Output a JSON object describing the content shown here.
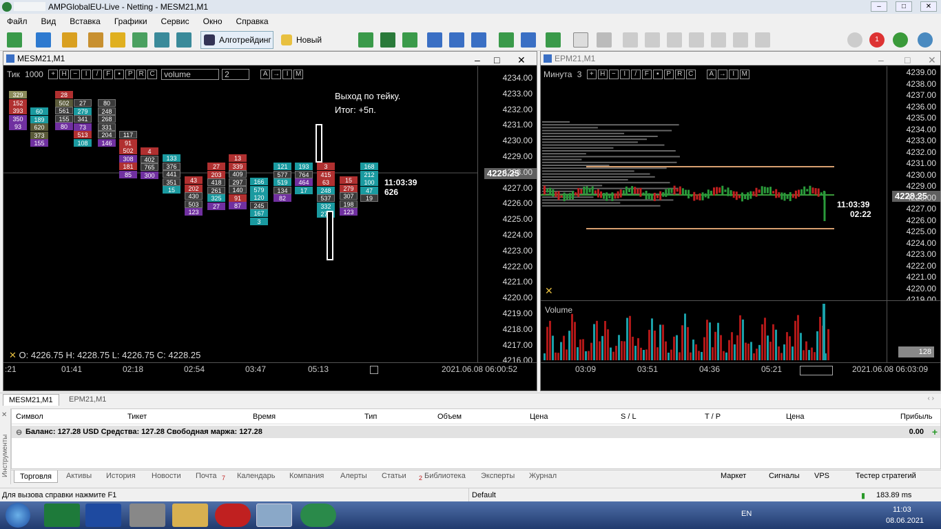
{
  "window": {
    "title": "AMPGlobalEU-Live - Netting - MESM21,M1"
  },
  "menu": [
    "Файл",
    "Вид",
    "Вставка",
    "Графики",
    "Сервис",
    "Окно",
    "Справка"
  ],
  "toolbar": {
    "algo_label": "Алготрейдинг",
    "order_label": "Новый ордер",
    "alerts_badge": "1"
  },
  "left_chart": {
    "title": "MESM21,M1",
    "mode_label": "Тик",
    "mode_value": "1000",
    "buttons": [
      "+",
      "H",
      "−",
      "I",
      "/",
      "F",
      "▪",
      "P",
      "R",
      "C"
    ],
    "volume_select": "volume",
    "volume_number": "2",
    "right_buttons": [
      "A",
      "→",
      "I",
      "M"
    ],
    "annotation_line1": "Выход по тейку.",
    "annotation_line2": "Итог: +5п.",
    "timer": "11:03:39",
    "timer_sub": "626",
    "ohlc": "O: 4226.75  H: 4228.75  L: 4226.75  C: 4228.25",
    "price_label": "4228.25",
    "y_labels": [
      "4234.00",
      "4233.00",
      "4232.00",
      "4231.00",
      "4230.00",
      "4229.00",
      "4228.00",
      "4227.00",
      "4226.00",
      "4225.00",
      "4224.00",
      "4223.00",
      "4222.00",
      "4221.00",
      "4220.00",
      "4219.00",
      "4218.00",
      "4217.00",
      "4216.00"
    ],
    "x_labels": [
      ":21",
      "01:41",
      "02:18",
      "02:54",
      "03:47",
      "05:13"
    ],
    "x_date": "2021.06.08 06:00:52",
    "clusters": [
      {
        "v": [
          "329",
          "152",
          "393",
          "350",
          "93"
        ],
        "c": [
          "#8a8a5a",
          "#b03030",
          "#b03030",
          "#7030a0",
          "#7030a0"
        ]
      },
      {
        "v": [
          "60",
          "189",
          "620",
          "373",
          "155"
        ],
        "c": [
          "#1a9aa0",
          "#1a9aa0",
          "#5a5a3a",
          "#5a5a3a",
          "#7030a0"
        ]
      },
      {
        "v": [
          "28",
          "502",
          "561",
          "155",
          "80"
        ],
        "c": [
          "#b03030",
          "#5a5a3a",
          "#3a3a3a",
          "#3a3a3a",
          "#7030a0"
        ]
      },
      {
        "v": [
          "27",
          "279",
          "341",
          "73",
          "513",
          "108"
        ],
        "c": [
          "#3a3a3a",
          "#1a9aa0",
          "#3a3a3a",
          "#7030a0",
          "#b03030",
          "#1a9aa0"
        ]
      },
      {
        "v": [
          "80",
          "248",
          "268",
          "331",
          "204",
          "146"
        ],
        "c": [
          "#3a3a3a",
          "#3a3a3a",
          "#3a3a3a",
          "#3a3a3a",
          "#3a3a3a",
          "#7030a0"
        ]
      },
      {
        "v": [
          "117",
          "91",
          "502",
          "308",
          "181",
          "85"
        ],
        "c": [
          "#3a3a3a",
          "#b03030",
          "#b03030",
          "#7030a0",
          "#b03030",
          "#7030a0"
        ]
      },
      {
        "v": [
          "4",
          "402",
          "765",
          "300"
        ],
        "c": [
          "#b03030",
          "#3a3a3a",
          "#3a3a3a",
          "#7030a0"
        ]
      },
      {
        "v": [
          "133",
          "376",
          "441",
          "351",
          "15"
        ],
        "c": [
          "#1a9aa0",
          "#3a3a3a",
          "#3a3a3a",
          "#3a3a3a",
          "#1a9aa0"
        ]
      },
      {
        "v": [
          "43",
          "202",
          "430",
          "503",
          "123"
        ],
        "c": [
          "#b03030",
          "#b03030",
          "#3a3a3a",
          "#3a3a3a",
          "#7030a0"
        ]
      },
      {
        "v": [
          "27",
          "203",
          "418",
          "261",
          "325",
          "27"
        ],
        "c": [
          "#b03030",
          "#b03030",
          "#3a3a3a",
          "#3a3a3a",
          "#1a9aa0",
          "#7030a0"
        ]
      },
      {
        "v": [
          "13",
          "339",
          "409",
          "297",
          "140",
          "91",
          "87"
        ],
        "c": [
          "#b03030",
          "#b03030",
          "#3a3a3a",
          "#3a3a3a",
          "#3a3a3a",
          "#b03030",
          "#7030a0"
        ]
      },
      {
        "v": [
          "166",
          "579",
          "120",
          "245",
          "167",
          "3"
        ],
        "c": [
          "#1a9aa0",
          "#1a9aa0",
          "#1a9aa0",
          "#3a3a3a",
          "#1a9aa0",
          "#1a9aa0"
        ]
      },
      {
        "v": [
          "121",
          "577",
          "519",
          "134",
          "82"
        ],
        "c": [
          "#1a9aa0",
          "#3a3a3a",
          "#1a9aa0",
          "#3a3a3a",
          "#7030a0"
        ]
      },
      {
        "v": [
          "193",
          "764",
          "464",
          "17"
        ],
        "c": [
          "#1a9aa0",
          "#3a3a3a",
          "#7030a0",
          "#1a9aa0"
        ]
      },
      {
        "v": [
          "3",
          "415",
          "63",
          "248",
          "537",
          "332",
          "273"
        ],
        "c": [
          "#b03030",
          "#b03030",
          "#b03030",
          "#1a9aa0",
          "#3a3a3a",
          "#1a9aa0",
          "#1a9aa0"
        ]
      },
      {
        "v": [
          "15",
          "279",
          "307",
          "198",
          "123"
        ],
        "c": [
          "#b03030",
          "#b03030",
          "#3a3a3a",
          "#3a3a3a",
          "#7030a0"
        ]
      },
      {
        "v": [
          "168",
          "212",
          "100",
          "47",
          "19"
        ],
        "c": [
          "#1a9aa0",
          "#1a9aa0",
          "#1a9aa0",
          "#1a9aa0",
          "#3a3a3a"
        ]
      }
    ]
  },
  "right_chart": {
    "title": "EPM21,M1",
    "mode_label": "Минута",
    "mode_value": "3",
    "buttons": [
      "+",
      "H",
      "−",
      "I",
      "/",
      "F",
      "▪",
      "P",
      "R",
      "C"
    ],
    "right_buttons": [
      "A",
      "→",
      "I",
      "M"
    ],
    "timer": "11:03:39",
    "timer_sub": "02:22",
    "price_label": "4228.25",
    "y_labels": [
      "4239.00",
      "4238.00",
      "4237.00",
      "4236.00",
      "4235.00",
      "4234.00",
      "4233.00",
      "4232.00",
      "4231.00",
      "4230.00",
      "4229.00",
      "4228.00",
      "4227.00",
      "4226.00",
      "4225.00",
      "4224.00",
      "4223.00",
      "4222.00",
      "4221.00",
      "4220.00",
      "4219.00"
    ],
    "volume_label": "Volume",
    "volume_value": "128",
    "x_labels": [
      "03:09",
      "03:51",
      "04:36",
      "05:21"
    ],
    "x_date": "2021.06.08 06:03:09"
  },
  "bottom_tabs": [
    "MESM21,M1",
    "EPM21,M1"
  ],
  "terminal": {
    "columns": [
      "Символ",
      "Тикет",
      "Время",
      "Тип",
      "Объем",
      "Цена",
      "S / L",
      "T / P",
      "Цена",
      "Прибыль"
    ],
    "balance_line": "Баланс: 127.28 USD  Средства: 127.28  Свободная маржа: 127.28",
    "profit": "0.00",
    "side_label": "Инструменты"
  },
  "terminal_tabs": [
    "Торговля",
    "Активы",
    "История",
    "Новости",
    "Почта",
    "Календарь",
    "Компания",
    "Алерты",
    "Статьи",
    "Библиотека",
    "Эксперты",
    "Журнал"
  ],
  "mail_badge": "7",
  "articles_badge": "2",
  "terminal_right": [
    "Маркет",
    "Сигналы",
    "VPS",
    "Тестер стратегий"
  ],
  "status": {
    "help": "Для вызова справки нажмите F1",
    "profile": "Default",
    "ping": "183.89 ms"
  },
  "taskbar": {
    "lang": "EN",
    "time": "11:03",
    "date": "08.06.2021"
  },
  "colors": {
    "chart_bg": "#000000",
    "bull": "#1aa0a8",
    "bear": "#b01818",
    "accent": "#3a8a3a"
  }
}
